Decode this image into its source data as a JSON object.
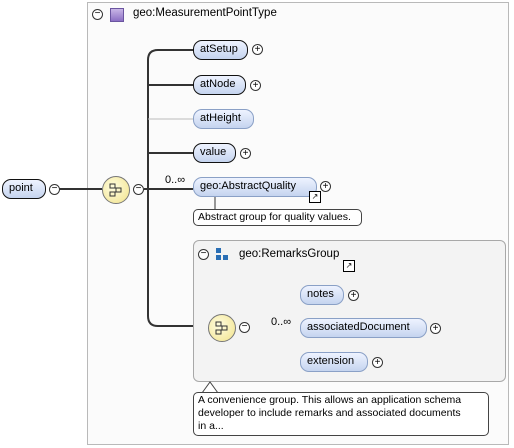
{
  "type_box": {
    "title": "geo:MeasurementPointType"
  },
  "root": {
    "label": "point"
  },
  "children": [
    {
      "label": "atSetup"
    },
    {
      "label": "atNode"
    },
    {
      "label": "atHeight"
    },
    {
      "label": "value"
    }
  ],
  "abstract_quality": {
    "label": "geo:AbstractQuality",
    "multiplicity": "0..∞",
    "note": "Abstract group for quality values."
  },
  "remarks_group": {
    "title": "geo:RemarksGroup",
    "multiplicity": "0..∞",
    "items": [
      {
        "label": "notes"
      },
      {
        "label": "associatedDocument"
      },
      {
        "label": "extension"
      }
    ],
    "note_lines": [
      "A convenience group. This allows an application schema",
      "developer to include remarks and associated documents",
      "in a..."
    ]
  },
  "symbols": {
    "collapse": "⊖",
    "expand": "⊕",
    "link": "↗"
  }
}
